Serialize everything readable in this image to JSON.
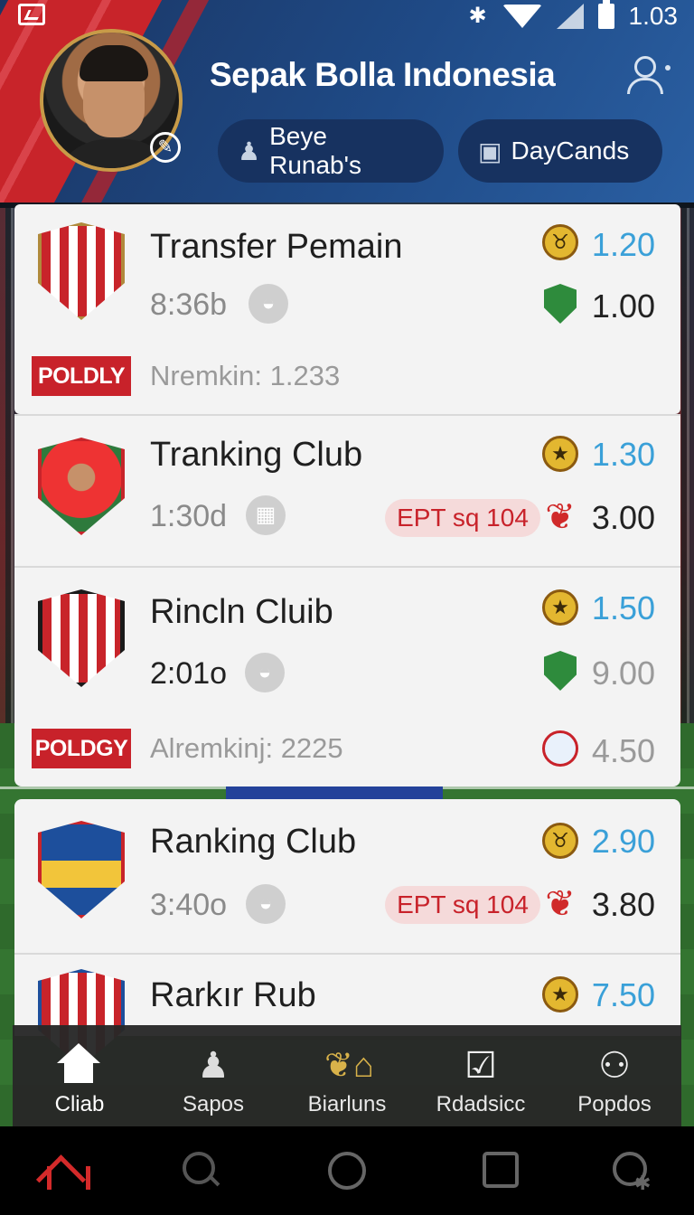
{
  "status_bar": {
    "time": "1.03"
  },
  "header": {
    "title": "Sepak Bolla Indonesia",
    "pills": [
      {
        "label": "Beye Runab's",
        "icon": "figure-icon"
      },
      {
        "label": "DayCands",
        "icon": "bag-icon"
      }
    ]
  },
  "cards": [
    {
      "title": "Transfer Pemain",
      "time": "8:36b",
      "badge": "POLDLY",
      "footer": "Nremkin: 1.233",
      "odds": [
        {
          "value": "1.20",
          "style": "blue",
          "icon": "bull-coin-icon"
        },
        {
          "value": "1.00",
          "style": "dark",
          "icon": "green-shield-icon"
        }
      ]
    },
    {
      "title": "Tranking Club",
      "time": "1:30d",
      "ept": "EPT sq 104",
      "odds": [
        {
          "value": "1.30",
          "style": "blue",
          "icon": "star-coin-icon"
        },
        {
          "value": "3.00",
          "style": "dark",
          "icon": "red-bird-icon"
        }
      ]
    },
    {
      "title": "Rincln Cluib",
      "time": "2:01o",
      "badge": "POLDGY",
      "footer": "Alremkinj: 2225",
      "odds": [
        {
          "value": "1.50",
          "style": "blue",
          "icon": "star-coin-icon"
        },
        {
          "value": "9.00",
          "style": "grey",
          "icon": "green-shield-icon"
        },
        {
          "value": "4.50",
          "style": "grey",
          "icon": "round-crest-icon"
        }
      ]
    },
    {
      "title": "Ranking Club",
      "time": "3:40o",
      "ept": "EPT sq 104",
      "odds": [
        {
          "value": "2.90",
          "style": "blue",
          "icon": "bull-coin-icon"
        },
        {
          "value": "3.80",
          "style": "dark",
          "icon": "red-bird-icon"
        }
      ]
    },
    {
      "title": "Rarkır Rub",
      "odds": [
        {
          "value": "7.50",
          "style": "blue",
          "icon": "star-coin-icon"
        }
      ]
    }
  ],
  "tabs": [
    {
      "label": "Cliab",
      "icon": "home-icon",
      "active": true
    },
    {
      "label": "Sapos",
      "icon": "person-icon"
    },
    {
      "label": "Biarluns",
      "icon": "laurel-house-icon"
    },
    {
      "label": "Rdadsicc",
      "icon": "checkbox-icon"
    },
    {
      "label": "Popdos",
      "icon": "user-icon"
    }
  ],
  "colors": {
    "header_blue": "#1f4a86",
    "accent_red": "#c8222a",
    "odds_blue": "#3aa0d8"
  }
}
